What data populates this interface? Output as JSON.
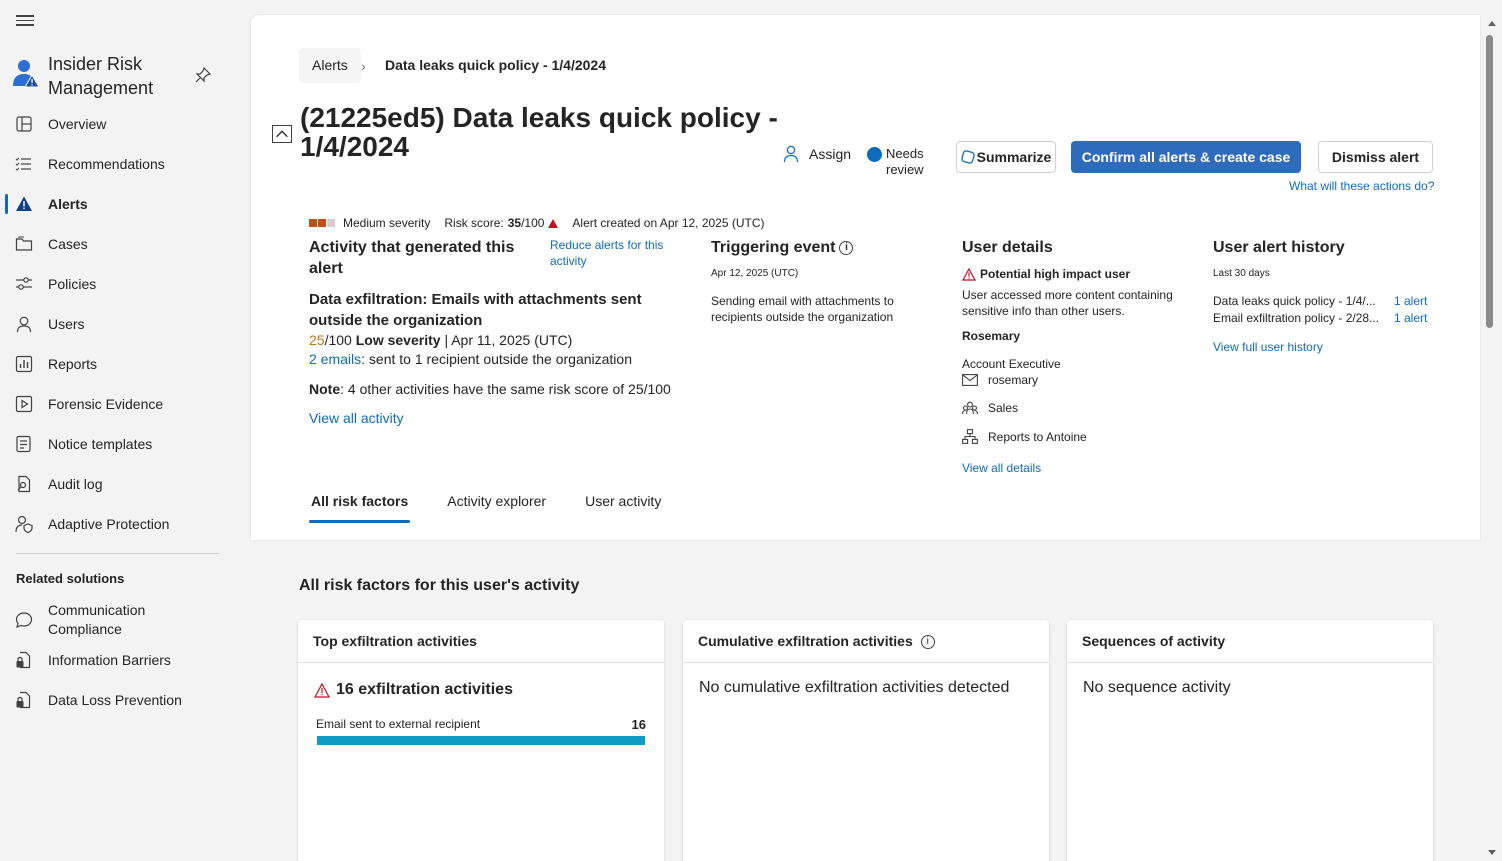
{
  "app": {
    "title": "Insider Risk Management"
  },
  "nav": {
    "items": [
      {
        "label": "Overview",
        "icon": "overview-icon"
      },
      {
        "label": "Recommendations",
        "icon": "checklist-icon"
      },
      {
        "label": "Alerts",
        "icon": "alert-icon"
      },
      {
        "label": "Cases",
        "icon": "folder-icon"
      },
      {
        "label": "Policies",
        "icon": "sliders-icon"
      },
      {
        "label": "Users",
        "icon": "user-icon"
      },
      {
        "label": "Reports",
        "icon": "chart-icon"
      },
      {
        "label": "Forensic Evidence",
        "icon": "video-icon"
      },
      {
        "label": "Notice templates",
        "icon": "template-icon"
      },
      {
        "label": "Audit log",
        "icon": "search-doc-icon"
      },
      {
        "label": "Adaptive Protection",
        "icon": "person-shield-icon"
      }
    ],
    "related_title": "Related solutions",
    "related": [
      {
        "label": "Communication Compliance",
        "icon": "chat-icon"
      },
      {
        "label": "Information Barriers",
        "icon": "lock-doc-icon"
      },
      {
        "label": "Data Loss Prevention",
        "icon": "lock-doc-icon"
      }
    ]
  },
  "breadcrumb": {
    "parent": "Alerts",
    "current": "Data leaks quick policy - 1/4/2024"
  },
  "page_title": "(21225ed5) Data leaks quick policy - 1/4/2024",
  "actions": {
    "assign": "Assign",
    "status_line1": "Needs",
    "status_line2": "review",
    "summarize": "Summarize",
    "confirm": "Confirm all alerts & create case",
    "dismiss": "Dismiss alert",
    "what_link": "What will these actions do?"
  },
  "severity": {
    "label": "Medium severity",
    "risk_label": "Risk score:",
    "risk_value": "35",
    "risk_max": "/100",
    "created": "Alert created on Apr 12, 2025 (UTC)",
    "colors": {
      "on": "#c24f1a",
      "off": "#d1d1d1",
      "up": "#c50f1f"
    }
  },
  "activity": {
    "title": "Activity that generated this alert",
    "reduce_link": "Reduce alerts for this activity",
    "headline": "Data exfiltration: Emails with attachments sent outside the organization",
    "score": "25",
    "score_rest": "/100",
    "severity_text": "Low severity",
    "date": "| Apr 11, 2025 (UTC)",
    "emails_link": "2 emails",
    "emails_rest": ": sent to 1 recipient outside the organization",
    "note_label": "Note",
    "note_text": ": 4 other activities have the same risk score of 25/100",
    "view_all": "View all activity"
  },
  "triggering": {
    "title": "Triggering event",
    "date": "Apr 12, 2025 (UTC)",
    "desc": "Sending email with attachments to recipients outside the organization"
  },
  "user_details": {
    "title": "User details",
    "impact": "Potential high impact user",
    "desc": "User accessed more content containing sensitive info than other users.",
    "name": "Rosemary",
    "role": "Account Executive",
    "email": "rosemary",
    "department": "Sales",
    "manager": "Reports to Antoine",
    "view_all": "View all details"
  },
  "history": {
    "title": "User alert history",
    "period": "Last 30 days",
    "rows": [
      {
        "name": "Data leaks quick policy - 1/4/...",
        "count": "1 alert"
      },
      {
        "name": "Email exfiltration policy - 2/28...",
        "count": "1 alert"
      }
    ],
    "view_full": "View full user history"
  },
  "tabs": [
    {
      "label": "All risk factors",
      "active": true
    },
    {
      "label": "Activity explorer",
      "active": false
    },
    {
      "label": "User activity",
      "active": false
    }
  ],
  "risk_section": {
    "title": "All risk factors for this user's activity",
    "card1": {
      "title": "Top exfiltration activities",
      "count_text": "16 exfiltration activities",
      "bar_label": "Email sent to external recipient",
      "bar_value": "16"
    },
    "card2": {
      "title": "Cumulative exfiltration activities",
      "empty": "No cumulative exfiltration activities detected"
    },
    "card3": {
      "title": "Sequences of activity",
      "empty": "No sequence activity"
    }
  }
}
